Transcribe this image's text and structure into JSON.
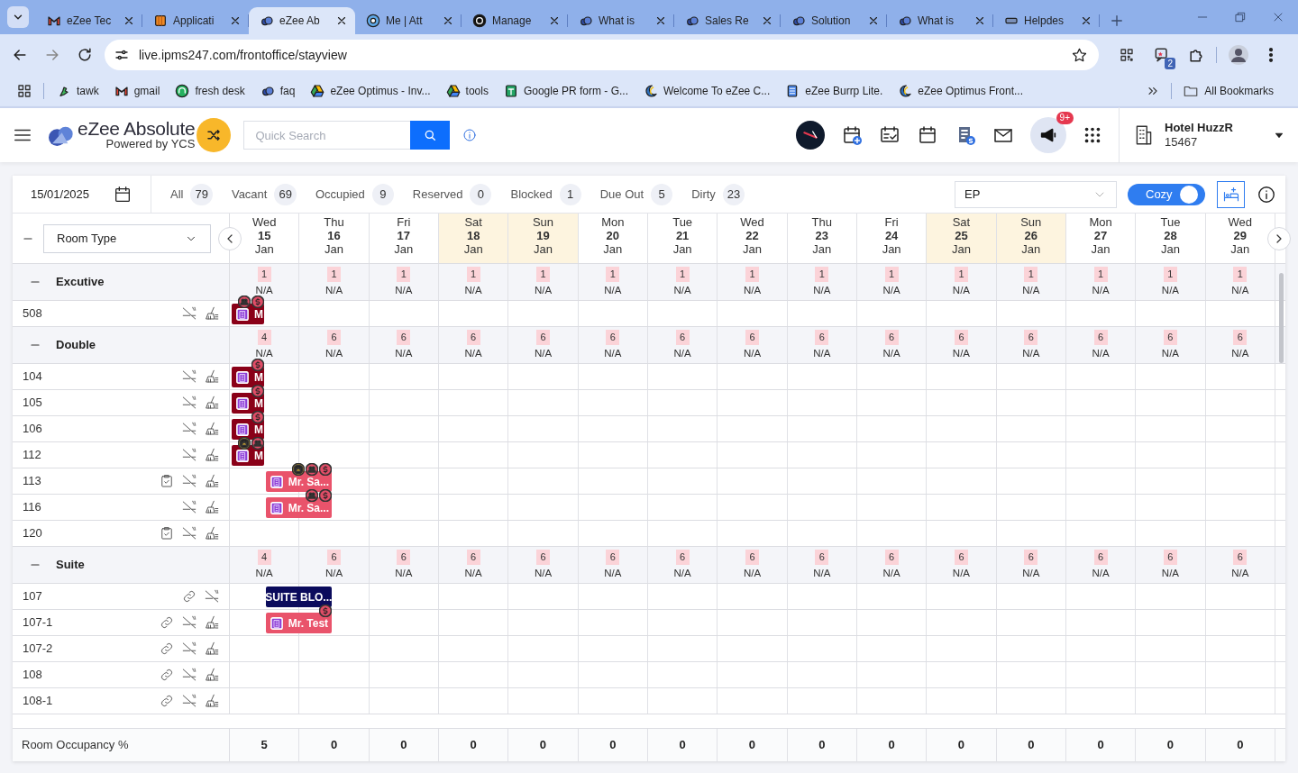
{
  "browser": {
    "tabs": [
      {
        "title": "eZee Tec",
        "kind": "mail",
        "selected": false
      },
      {
        "title": "Applicati",
        "kind": "box",
        "selected": false
      },
      {
        "title": "eZee Ab",
        "kind": "cloud",
        "selected": true
      },
      {
        "title": "Me | Att",
        "kind": "round",
        "selected": false
      },
      {
        "title": "Manage",
        "kind": "knot",
        "selected": false
      },
      {
        "title": "What is",
        "kind": "cloud",
        "selected": false
      },
      {
        "title": "Sales Re",
        "kind": "cloud",
        "selected": false
      },
      {
        "title": "Solution",
        "kind": "cloud",
        "selected": false
      },
      {
        "title": "What is",
        "kind": "cloud",
        "selected": false
      },
      {
        "title": "Helpdes",
        "kind": "bar",
        "selected": false
      }
    ],
    "address": "live.ipms247.com/frontoffice/stayview",
    "extension_count": "2",
    "bookmarks": [
      {
        "label": "tawk",
        "kind": "bird"
      },
      {
        "label": "gmail",
        "kind": "mail"
      },
      {
        "label": "fresh desk",
        "kind": "headset"
      },
      {
        "label": "faq",
        "kind": "cloud"
      },
      {
        "label": "eZee Optimus - Inv...",
        "kind": "drive"
      },
      {
        "label": "tools",
        "kind": "drive"
      },
      {
        "label": "Google PR form - G...",
        "kind": "sheet"
      },
      {
        "label": "Welcome To eZee C...",
        "kind": "swirl"
      },
      {
        "label": "eZee Burrp Lite.",
        "kind": "doc"
      },
      {
        "label": "eZee Optimus Front...",
        "kind": "swirl"
      }
    ],
    "all_bookmarks": "All Bookmarks"
  },
  "app": {
    "brand": "eZee Absolute",
    "tagline": "Powered by YCS",
    "search_placeholder": "Quick Search",
    "notification_count": "9+",
    "hotel": {
      "name": "Hotel HuzzR",
      "code": "15467"
    }
  },
  "toolbar": {
    "date": "15/01/2025",
    "filters": [
      {
        "label": "All",
        "count": "79"
      },
      {
        "label": "Vacant",
        "count": "69"
      },
      {
        "label": "Occupied",
        "count": "9"
      },
      {
        "label": "Reserved",
        "count": "0"
      },
      {
        "label": "Blocked",
        "count": "1"
      },
      {
        "label": "Due Out",
        "count": "5"
      },
      {
        "label": "Dirty",
        "count": "23"
      }
    ],
    "rate_plan": "EP",
    "view_toggle": {
      "label": "Cozy",
      "on": true
    }
  },
  "grid": {
    "group_by": "Room Type",
    "days": [
      {
        "dow": "Wed",
        "day": "15",
        "month": "Jan",
        "weekend": false
      },
      {
        "dow": "Thu",
        "day": "16",
        "month": "Jan",
        "weekend": false
      },
      {
        "dow": "Fri",
        "day": "17",
        "month": "Jan",
        "weekend": false
      },
      {
        "dow": "Sat",
        "day": "18",
        "month": "Jan",
        "weekend": true
      },
      {
        "dow": "Sun",
        "day": "19",
        "month": "Jan",
        "weekend": true
      },
      {
        "dow": "Mon",
        "day": "20",
        "month": "Jan",
        "weekend": false
      },
      {
        "dow": "Tue",
        "day": "21",
        "month": "Jan",
        "weekend": false
      },
      {
        "dow": "Wed",
        "day": "22",
        "month": "Jan",
        "weekend": false
      },
      {
        "dow": "Thu",
        "day": "23",
        "month": "Jan",
        "weekend": false
      },
      {
        "dow": "Fri",
        "day": "24",
        "month": "Jan",
        "weekend": false
      },
      {
        "dow": "Sat",
        "day": "25",
        "month": "Jan",
        "weekend": true
      },
      {
        "dow": "Sun",
        "day": "26",
        "month": "Jan",
        "weekend": true
      },
      {
        "dow": "Mon",
        "day": "27",
        "month": "Jan",
        "weekend": false
      },
      {
        "dow": "Tue",
        "day": "28",
        "month": "Jan",
        "weekend": false
      },
      {
        "dow": "Wed",
        "day": "29",
        "month": "Jan",
        "weekend": false
      }
    ],
    "groups": [
      {
        "name": "Excutive",
        "expanded": true,
        "availability": [
          {
            "count": "1",
            "rate": "N/A"
          },
          {
            "count": "1",
            "rate": "N/A"
          },
          {
            "count": "1",
            "rate": "N/A"
          },
          {
            "count": "1",
            "rate": "N/A"
          },
          {
            "count": "1",
            "rate": "N/A"
          },
          {
            "count": "1",
            "rate": "N/A"
          },
          {
            "count": "1",
            "rate": "N/A"
          },
          {
            "count": "1",
            "rate": "N/A"
          },
          {
            "count": "1",
            "rate": "N/A"
          },
          {
            "count": "1",
            "rate": "N/A"
          },
          {
            "count": "1",
            "rate": "N/A"
          },
          {
            "count": "1",
            "rate": "N/A"
          },
          {
            "count": "1",
            "rate": "N/A"
          },
          {
            "count": "1",
            "rate": "N/A"
          },
          {
            "count": "1",
            "rate": "N/A"
          }
        ],
        "rooms": [
          {
            "number": "508",
            "icons": [
              {
                "kind": "no-smoking"
              },
              {
                "kind": "housekeeping"
              }
            ],
            "bookings": [
              {
                "kind": "in-house",
                "text": "M",
                "badges": [
                  {
                    "kind": "group"
                  },
                  {
                    "kind": "dollar"
                  }
                ]
              }
            ]
          }
        ]
      },
      {
        "name": "Double",
        "expanded": true,
        "availability": [
          {
            "count": "4",
            "rate": "N/A"
          },
          {
            "count": "6",
            "rate": "N/A"
          },
          {
            "count": "6",
            "rate": "N/A"
          },
          {
            "count": "6",
            "rate": "N/A"
          },
          {
            "count": "6",
            "rate": "N/A"
          },
          {
            "count": "6",
            "rate": "N/A"
          },
          {
            "count": "6",
            "rate": "N/A"
          },
          {
            "count": "6",
            "rate": "N/A"
          },
          {
            "count": "6",
            "rate": "N/A"
          },
          {
            "count": "6",
            "rate": "N/A"
          },
          {
            "count": "6",
            "rate": "N/A"
          },
          {
            "count": "6",
            "rate": "N/A"
          },
          {
            "count": "6",
            "rate": "N/A"
          },
          {
            "count": "6",
            "rate": "N/A"
          },
          {
            "count": "6",
            "rate": "N/A"
          }
        ],
        "rooms": [
          {
            "number": "104",
            "icons": [
              {
                "kind": "no-smoking"
              },
              {
                "kind": "housekeeping"
              }
            ],
            "bookings": [
              {
                "kind": "in-house",
                "text": "M",
                "badges": [
                  {
                    "kind": "dollar"
                  }
                ]
              }
            ]
          },
          {
            "number": "105",
            "icons": [
              {
                "kind": "no-smoking"
              },
              {
                "kind": "housekeeping"
              }
            ],
            "bookings": [
              {
                "kind": "in-house",
                "text": "M",
                "badges": [
                  {
                    "kind": "dollar"
                  }
                ]
              }
            ]
          },
          {
            "number": "106",
            "icons": [
              {
                "kind": "no-smoking"
              },
              {
                "kind": "housekeeping"
              }
            ],
            "bookings": [
              {
                "kind": "in-house",
                "text": "M",
                "badges": [
                  {
                    "kind": "dollar"
                  }
                ]
              }
            ]
          },
          {
            "number": "112",
            "icons": [
              {
                "kind": "no-smoking"
              },
              {
                "kind": "housekeeping"
              }
            ],
            "bookings": [
              {
                "kind": "in-house",
                "text": "M",
                "badges": [
                  {
                    "kind": "crown"
                  },
                  {
                    "kind": "group"
                  }
                ]
              }
            ]
          },
          {
            "number": "113",
            "icons": [
              {
                "kind": "checklist"
              },
              {
                "kind": "no-smoking"
              },
              {
                "kind": "housekeeping"
              }
            ],
            "bookings": [
              {
                "kind": "reservation",
                "text": "Mr. Sa...",
                "badges": [
                  {
                    "kind": "crown"
                  },
                  {
                    "kind": "group"
                  },
                  {
                    "kind": "dollar"
                  }
                ]
              }
            ]
          },
          {
            "number": "116",
            "icons": [
              {
                "kind": "no-smoking"
              },
              {
                "kind": "housekeeping"
              }
            ],
            "bookings": [
              {
                "kind": "reservation",
                "text": "Mr. Sa...",
                "badges": [
                  {
                    "kind": "group"
                  },
                  {
                    "kind": "dollar"
                  }
                ]
              }
            ]
          },
          {
            "number": "120",
            "icons": [
              {
                "kind": "checklist"
              },
              {
                "kind": "no-smoking"
              },
              {
                "kind": "housekeeping"
              }
            ]
          }
        ]
      },
      {
        "name": "Suite",
        "expanded": true,
        "availability": [
          {
            "count": "4",
            "rate": "N/A"
          },
          {
            "count": "6",
            "rate": "N/A"
          },
          {
            "count": "6",
            "rate": "N/A"
          },
          {
            "count": "6",
            "rate": "N/A"
          },
          {
            "count": "6",
            "rate": "N/A"
          },
          {
            "count": "6",
            "rate": "N/A"
          },
          {
            "count": "6",
            "rate": "N/A"
          },
          {
            "count": "6",
            "rate": "N/A"
          },
          {
            "count": "6",
            "rate": "N/A"
          },
          {
            "count": "6",
            "rate": "N/A"
          },
          {
            "count": "6",
            "rate": "N/A"
          },
          {
            "count": "6",
            "rate": "N/A"
          },
          {
            "count": "6",
            "rate": "N/A"
          },
          {
            "count": "6",
            "rate": "N/A"
          },
          {
            "count": "6",
            "rate": "N/A"
          }
        ],
        "rooms": [
          {
            "number": "107",
            "icons": [
              {
                "kind": "link"
              },
              {
                "kind": "no-smoking"
              }
            ],
            "bookings": [
              {
                "kind": "block",
                "text": "SUITE BLO..."
              }
            ]
          },
          {
            "number": "107-1",
            "icons": [
              {
                "kind": "link"
              },
              {
                "kind": "no-smoking"
              },
              {
                "kind": "housekeeping"
              }
            ],
            "bookings": [
              {
                "kind": "reservation",
                "text": "Mr. Test",
                "badges": [
                  {
                    "kind": "dollar"
                  }
                ]
              }
            ]
          },
          {
            "number": "107-2",
            "icons": [
              {
                "kind": "link"
              },
              {
                "kind": "no-smoking"
              },
              {
                "kind": "housekeeping"
              }
            ]
          },
          {
            "number": "108",
            "icons": [
              {
                "kind": "link"
              },
              {
                "kind": "no-smoking"
              },
              {
                "kind": "housekeeping"
              }
            ]
          },
          {
            "number": "108-1",
            "icons": [
              {
                "kind": "link"
              },
              {
                "kind": "no-smoking"
              },
              {
                "kind": "housekeeping"
              }
            ]
          }
        ]
      }
    ],
    "occupancy": {
      "label": "Room Occupancy %",
      "values": [
        "5",
        "0",
        "0",
        "0",
        "0",
        "0",
        "0",
        "0",
        "0",
        "0",
        "0",
        "0",
        "0",
        "0",
        "0"
      ]
    }
  }
}
